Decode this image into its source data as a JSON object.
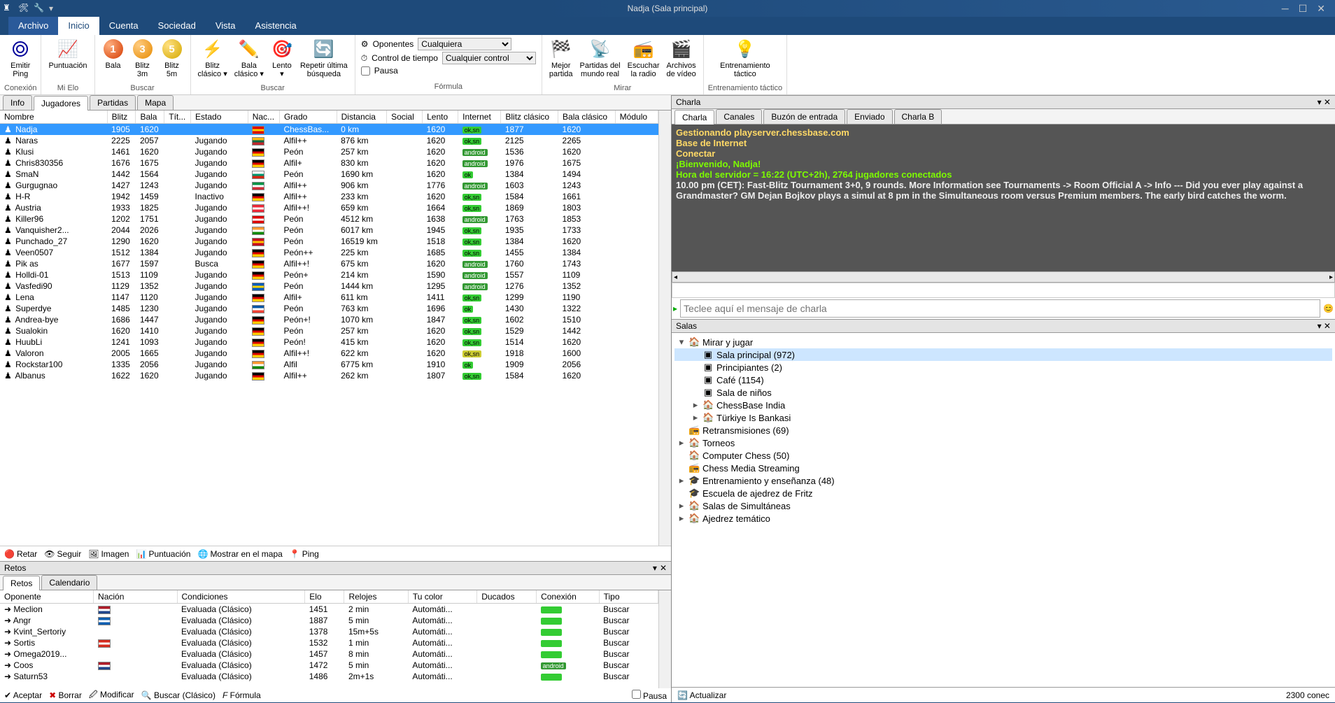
{
  "title": "Nadja (Sala principal)",
  "menus": [
    "Archivo",
    "Inicio",
    "Cuenta",
    "Sociedad",
    "Vista",
    "Asistencia"
  ],
  "ribbon": {
    "groups": [
      {
        "label": "Conexión",
        "items": [
          {
            "label": "Emitir\nPing"
          }
        ]
      },
      {
        "label": "Mi Elo",
        "items": [
          {
            "label": "Puntuación"
          }
        ]
      },
      {
        "label": "Buscar",
        "items": [
          {
            "label": "Bala"
          },
          {
            "label": "Blitz\n3m"
          },
          {
            "label": "Blitz\n5m"
          }
        ]
      },
      {
        "label": "Buscar",
        "items": [
          {
            "label": "Blitz\nclásico ▾"
          },
          {
            "label": "Bala\nclásico ▾"
          },
          {
            "label": "Lento\n▾"
          },
          {
            "label": "Repetir última\nbúsqueda"
          }
        ]
      },
      {
        "label": "Fórmula",
        "form": {
          "oponentes": "Oponentes",
          "control": "Control de tiempo",
          "pausa": "Pausa",
          "opc1": "Cualquiera",
          "opc2": "Cualquier control"
        }
      },
      {
        "label": "Mirar",
        "items": [
          {
            "label": "Mejor\npartida"
          },
          {
            "label": "Partidas del\nmundo real"
          },
          {
            "label": "Escuchar\nla radio"
          },
          {
            "label": "Archivos\nde vídeo"
          }
        ]
      },
      {
        "label": "Entrenamiento táctico",
        "items": [
          {
            "label": "Entrenamiento\ntáctico"
          }
        ]
      }
    ]
  },
  "left_tabs": [
    "Info",
    "Jugadores",
    "Partidas",
    "Mapa"
  ],
  "players": {
    "columns": [
      "Nombre",
      "Blitz",
      "Bala",
      "Tít...",
      "Estado",
      "Nac...",
      "Grado",
      "Distancia",
      "Social",
      "Lento",
      "Internet",
      "Blitz clásico",
      "Bala clásico",
      "Módulo"
    ],
    "rows": [
      {
        "name": "Nadja",
        "blitz": "1905",
        "bala": "1620",
        "estado": "",
        "flag": "#d00-#ffcc00-#d00",
        "grado": "ChessBas...",
        "dist": "0 km",
        "lento": "1620",
        "net": "ok,sn",
        "ntype": "green",
        "bc": "1877",
        "balac": "1620",
        "sel": true
      },
      {
        "name": "Naras",
        "blitz": "2225",
        "bala": "2057",
        "estado": "Jugando",
        "flag": "#fdb913-#006a44-#c1272d",
        "grado": "Alfil++",
        "dist": "876 km",
        "lento": "1620",
        "net": "ok,sn",
        "ntype": "green",
        "bc": "2125",
        "balac": "2265"
      },
      {
        "name": "Klusi",
        "blitz": "1461",
        "bala": "1620",
        "estado": "Jugando",
        "flag": "#000-#d00-#ffcc00",
        "grado": "Peón",
        "dist": "257 km",
        "lento": "1620",
        "net": "android",
        "ntype": "android",
        "bc": "1536",
        "balac": "1620"
      },
      {
        "name": "Chris830356",
        "blitz": "1676",
        "bala": "1675",
        "estado": "Jugando",
        "flag": "#000-#d00-#ffcc00",
        "grado": "Alfil+",
        "dist": "830 km",
        "lento": "1620",
        "net": "android",
        "ntype": "android",
        "bc": "1976",
        "balac": "1675"
      },
      {
        "name": "SmaN",
        "blitz": "1442",
        "bala": "1564",
        "estado": "Jugando",
        "flag": "#fff-#00966e-#d62612",
        "grado": "Peón",
        "dist": "1690 km",
        "lento": "1620",
        "net": "ok",
        "ntype": "green",
        "bc": "1384",
        "balac": "1494"
      },
      {
        "name": "Gurgugnao",
        "blitz": "1427",
        "bala": "1243",
        "estado": "Jugando",
        "flag": "#009246-#fff-#ce2b37",
        "grado": "Alfil++",
        "dist": "906 km",
        "lento": "1776",
        "net": "android",
        "ntype": "android",
        "bc": "1603",
        "balac": "1243"
      },
      {
        "name": "H-R",
        "blitz": "1942",
        "bala": "1459",
        "estado": "Inactivo",
        "flag": "#000-#d00-#ffcc00",
        "grado": "Alfil++",
        "dist": "233 km",
        "lento": "1620",
        "net": "ok,sn",
        "ntype": "green",
        "bc": "1584",
        "balac": "1661"
      },
      {
        "name": "Austria",
        "blitz": "1933",
        "bala": "1825",
        "estado": "Jugando",
        "flag": "#ed2939-#fff-#ed2939",
        "grado": "Alfil++!",
        "dist": "659 km",
        "lento": "1664",
        "net": "ok,sn",
        "ntype": "green",
        "bc": "1869",
        "balac": "1803"
      },
      {
        "name": "Killer96",
        "blitz": "1202",
        "bala": "1751",
        "estado": "Jugando",
        "flag": "#d00-#fff-#d00",
        "grado": "Peón",
        "dist": "4512 km",
        "lento": "1638",
        "net": "android",
        "ntype": "android",
        "bc": "1763",
        "balac": "1853"
      },
      {
        "name": "Vanquisher2...",
        "blitz": "2044",
        "bala": "2026",
        "estado": "Jugando",
        "flag": "#f93-#fff-#128807",
        "grado": "Peón",
        "dist": "6017 km",
        "lento": "1945",
        "net": "ok,sn",
        "ntype": "green",
        "bc": "1935",
        "balac": "1733"
      },
      {
        "name": "Punchado_27",
        "blitz": "1290",
        "bala": "1620",
        "estado": "Jugando",
        "flag": "#c60b1e-#ffc400-#c60b1e",
        "grado": "Peón",
        "dist": "16519 km",
        "lento": "1518",
        "net": "ok,sn",
        "ntype": "green",
        "bc": "1384",
        "balac": "1620"
      },
      {
        "name": "Veen0507",
        "blitz": "1512",
        "bala": "1384",
        "estado": "Jugando",
        "flag": "#000-#d00-#ffcc00",
        "grado": "Peón++",
        "dist": "225 km",
        "lento": "1685",
        "net": "ok,sn",
        "ntype": "green",
        "bc": "1455",
        "balac": "1384"
      },
      {
        "name": "Pik as",
        "blitz": "1677",
        "bala": "1597",
        "estado": "Busca",
        "flag": "#000-#d00-#ffcc00",
        "grado": "Alfil++!",
        "dist": "675 km",
        "lento": "1620",
        "net": "android",
        "ntype": "android",
        "bc": "1760",
        "balac": "1743"
      },
      {
        "name": "Holldi-01",
        "blitz": "1513",
        "bala": "1109",
        "estado": "Jugando",
        "flag": "#000-#d00-#ffcc00",
        "grado": "Peón+",
        "dist": "214 km",
        "lento": "1590",
        "net": "android",
        "ntype": "android",
        "bc": "1557",
        "balac": "1109"
      },
      {
        "name": "Vasfedi90",
        "blitz": "1129",
        "bala": "1352",
        "estado": "Jugando",
        "flag": "#005bbb-#ffd500-#005bbb",
        "grado": "Peón",
        "dist": "1444 km",
        "lento": "1295",
        "net": "android",
        "ntype": "android",
        "bc": "1276",
        "balac": "1352"
      },
      {
        "name": "Lena",
        "blitz": "1147",
        "bala": "1120",
        "estado": "Jugando",
        "flag": "#000-#d00-#ffcc00",
        "grado": "Alfil+",
        "dist": "611 km",
        "lento": "1411",
        "net": "ok,sn",
        "ntype": "green",
        "bc": "1299",
        "balac": "1190"
      },
      {
        "name": "Superdye",
        "blitz": "1485",
        "bala": "1230",
        "estado": "Jugando",
        "flag": "#0055a4-#fff-#ef4135",
        "grado": "Peón",
        "dist": "763 km",
        "lento": "1696",
        "net": "ok",
        "ntype": "green",
        "bc": "1430",
        "balac": "1322"
      },
      {
        "name": "Andrea-bye",
        "blitz": "1686",
        "bala": "1447",
        "estado": "Jugando",
        "flag": "#000-#d00-#ffcc00",
        "grado": "Peón+!",
        "dist": "1070 km",
        "lento": "1847",
        "net": "ok,sn",
        "ntype": "green",
        "bc": "1602",
        "balac": "1510"
      },
      {
        "name": "Sualokin",
        "blitz": "1620",
        "bala": "1410",
        "estado": "Jugando",
        "flag": "#000-#d00-#ffcc00",
        "grado": "Peón",
        "dist": "257 km",
        "lento": "1620",
        "net": "ok,sn",
        "ntype": "green",
        "bc": "1529",
        "balac": "1442"
      },
      {
        "name": "HuubLi",
        "blitz": "1241",
        "bala": "1093",
        "estado": "Jugando",
        "flag": "#000-#d00-#ffcc00",
        "grado": "Peón!",
        "dist": "415 km",
        "lento": "1620",
        "net": "ok,sn",
        "ntype": "green",
        "bc": "1514",
        "balac": "1620"
      },
      {
        "name": "Valoron",
        "blitz": "2005",
        "bala": "1665",
        "estado": "Jugando",
        "flag": "#000-#d00-#ffcc00",
        "grado": "Alfil++!",
        "dist": "622 km",
        "lento": "1620",
        "net": "ok,sn",
        "ntype": "yellow",
        "bc": "1918",
        "balac": "1600"
      },
      {
        "name": "Rockstar100",
        "blitz": "1335",
        "bala": "2056",
        "estado": "Jugando",
        "flag": "#f93-#fff-#128807",
        "grado": "Alfil",
        "dist": "6775 km",
        "lento": "1910",
        "net": "ok",
        "ntype": "green",
        "bc": "1909",
        "balac": "2056"
      },
      {
        "name": "Albanus",
        "blitz": "1622",
        "bala": "1620",
        "estado": "Jugando",
        "flag": "#000-#d00-#ffcc00",
        "grado": "Alfil++",
        "dist": "262 km",
        "lento": "1807",
        "net": "ok,sn",
        "ntype": "green",
        "bc": "1584",
        "balac": "1620"
      }
    ],
    "actions": [
      "Retar",
      "Seguir",
      "Imagen",
      "Puntuación",
      "Mostrar en el mapa",
      "Ping"
    ]
  },
  "retos": {
    "header": "Retos",
    "tabs": [
      "Retos",
      "Calendario"
    ],
    "columns": [
      "Oponente",
      "Nación",
      "Condiciones",
      "Elo",
      "Relojes",
      "Tu color",
      "Ducados",
      "Conexión",
      "Tipo"
    ],
    "rows": [
      {
        "op": "Meclion",
        "flag": "#ae1c28-#fff-#21468b",
        "cond": "Evaluada (Clásico)",
        "elo": "1451",
        "reloj": "2 min",
        "color": "Automáti...",
        "conn": "green",
        "tipo": "Buscar"
      },
      {
        "op": "Angr",
        "flag": "#0d5eaf-#fff-#0d5eaf",
        "cond": "Evaluada (Clásico)",
        "elo": "1887",
        "reloj": "5 min",
        "color": "Automáti...",
        "conn": "green",
        "tipo": "Buscar"
      },
      {
        "op": "Kvint_Sertoriy",
        "flag": "",
        "cond": "Evaluada (Clásico)",
        "elo": "1378",
        "reloj": "15m+5s",
        "color": "Automáti...",
        "conn": "green",
        "tipo": "Buscar"
      },
      {
        "op": "Sortis",
        "flag": "#d52b1e-#fff-#d52b1e",
        "cond": "Evaluada (Clásico)",
        "elo": "1532",
        "reloj": "1 min",
        "color": "Automáti...",
        "conn": "green",
        "tipo": "Buscar"
      },
      {
        "op": "Omega2019...",
        "flag": "",
        "cond": "Evaluada (Clásico)",
        "elo": "1457",
        "reloj": "8 min",
        "color": "Automáti...",
        "conn": "green",
        "tipo": "Buscar"
      },
      {
        "op": "Coos",
        "flag": "#ae1c28-#fff-#21468b",
        "cond": "Evaluada (Clásico)",
        "elo": "1472",
        "reloj": "5 min",
        "color": "Automáti...",
        "conn": "android",
        "tipo": "Buscar"
      },
      {
        "op": "Saturn53",
        "flag": "",
        "cond": "Evaluada (Clásico)",
        "elo": "1486",
        "reloj": "2m+1s",
        "color": "Automáti...",
        "conn": "green",
        "tipo": "Buscar"
      }
    ],
    "footer": [
      "Aceptar",
      "Borrar",
      "Modificar",
      "Buscar (Clásico)",
      "Fórmula"
    ],
    "pausa": "Pausa"
  },
  "chat": {
    "header": "Charla",
    "tabs": [
      "Charla",
      "Canales",
      "Buzón de entrada",
      "Enviado",
      "Charla B"
    ],
    "lines": [
      {
        "cls": "y",
        "t": "Gestionando playserver.chessbase.com"
      },
      {
        "cls": "y",
        "t": "Base de Internet"
      },
      {
        "cls": "y",
        "t": "Conectar"
      },
      {
        "cls": "g",
        "t": "¡Bienvenido, Nadja!"
      },
      {
        "cls": "g",
        "t": "Hora del servidor = 16:22 (UTC+2h), 2764 jugadores conectados"
      },
      {
        "cls": "w",
        "t": "10.00 pm (CET): Fast-Blitz Tournament 3+0, 9 rounds. More Information see Tournaments -> Room Official A -> Info --- Did you ever play against a Grandmaster? GM Dejan Bojkov plays a simul at 8 pm in the Simultaneous room versus Premium members. The early bird catches the worm."
      }
    ],
    "placeholder": "Teclee aquí el mensaje de charla"
  },
  "rooms": {
    "header": "Salas",
    "tree": [
      {
        "indent": 1,
        "exp": "▾",
        "icon": "🏠",
        "label": "Mirar y jugar"
      },
      {
        "indent": 2,
        "exp": "",
        "icon": "▣",
        "label": "Sala principal  (972)",
        "sel": true
      },
      {
        "indent": 2,
        "exp": "",
        "icon": "▣",
        "label": "Principiantes  (2)"
      },
      {
        "indent": 2,
        "exp": "",
        "icon": "▣",
        "label": "Café  (1154)"
      },
      {
        "indent": 2,
        "exp": "",
        "icon": "▣",
        "label": "Sala de niños"
      },
      {
        "indent": 2,
        "exp": "▸",
        "icon": "🏠",
        "label": "ChessBase India"
      },
      {
        "indent": 2,
        "exp": "▸",
        "icon": "🏠",
        "label": "Türkiye Is Bankasi"
      },
      {
        "indent": 1,
        "exp": "",
        "icon": "📻",
        "label": "Retransmisiones  (69)"
      },
      {
        "indent": 1,
        "exp": "▸",
        "icon": "🏠",
        "label": "Torneos"
      },
      {
        "indent": 1,
        "exp": "",
        "icon": "🏠",
        "label": "Computer Chess  (50)"
      },
      {
        "indent": 1,
        "exp": "",
        "icon": "📻",
        "label": "Chess Media Streaming"
      },
      {
        "indent": 1,
        "exp": "▸",
        "icon": "🎓",
        "label": "Entrenamiento y enseñanza  (48)"
      },
      {
        "indent": 1,
        "exp": "",
        "icon": "🎓",
        "label": "Escuela de ajedrez de Fritz"
      },
      {
        "indent": 1,
        "exp": "▸",
        "icon": "🏠",
        "label": "Salas de Simultáneas"
      },
      {
        "indent": 1,
        "exp": "▸",
        "icon": "🏠",
        "label": "Ajedrez temático"
      }
    ]
  },
  "status": {
    "act": "Actualizar",
    "conn": "2300 conec"
  }
}
